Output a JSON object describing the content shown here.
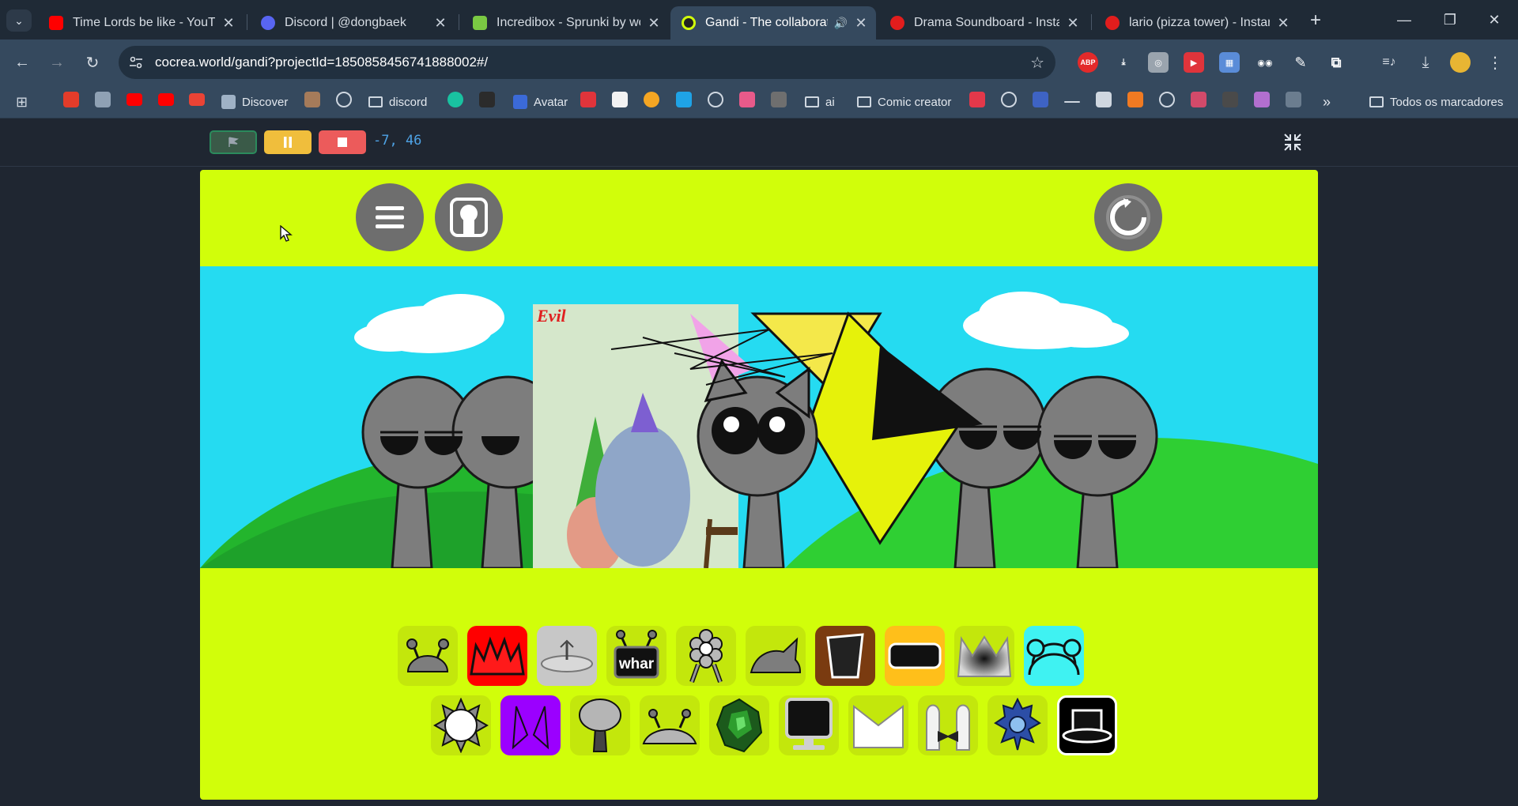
{
  "tabs": [
    {
      "title": "Time Lords be like - YouTube",
      "favicon": "youtube-icon",
      "color": "#ff0000"
    },
    {
      "title": "Discord | @dongbaek",
      "favicon": "discord-icon",
      "color": "#5865f2"
    },
    {
      "title": "Incredibox - Sprunki by wolfey",
      "favicon": "sprunki-icon",
      "color": "#7ac943"
    },
    {
      "title": "Gandi - The collaborative",
      "favicon": "gandi-icon",
      "color": "#d1fe0a",
      "active": true,
      "audio": true
    },
    {
      "title": "Drama Soundboard - Instant",
      "favicon": "myinstants-icon",
      "color": "#e11d1d"
    },
    {
      "title": "lario (pizza tower) - Instant",
      "favicon": "myinstants-icon",
      "color": "#e11d1d"
    }
  ],
  "address": {
    "url": "cocrea.world/gandi?projectId=1850858456741888002#/"
  },
  "extensions": [
    {
      "name": "adblock-icon",
      "label": "ABP",
      "color": "#e32a2a"
    },
    {
      "name": "download-helper-icon",
      "label": "⤓",
      "color": "#35495e"
    },
    {
      "name": "camera-ext-icon",
      "label": "◎",
      "color": "#9aa4ae"
    },
    {
      "name": "video-ext-icon",
      "label": "▶",
      "color": "#e0343b"
    },
    {
      "name": "photo-ext-icon",
      "label": "▦",
      "color": "#5a8cd8"
    },
    {
      "name": "glasses-ext-icon",
      "label": "◉◉",
      "color": "#35495e"
    },
    {
      "name": "pen-ext-icon",
      "label": "✎",
      "color": "#35495e"
    },
    {
      "name": "puzzle-icon",
      "label": "⧉",
      "color": "#35495e"
    }
  ],
  "bookmarks": {
    "discover": "Discover",
    "discord": "discord",
    "avatar": "Avatar",
    "ai": "ai",
    "comic": "Comic creator",
    "all": "Todos os marcadores"
  },
  "gandi": {
    "coords": "-7, 46",
    "scene_label": "Evil"
  },
  "tray": {
    "label_whar": "whar",
    "row1": [
      {
        "name": "tray-item-antenna-dome",
        "bg": "#c3e70c"
      },
      {
        "name": "tray-item-red-spikes",
        "bg": "#ff0000"
      },
      {
        "name": "tray-item-satellite",
        "bg": "#c7c7c7"
      },
      {
        "name": "tray-item-whar-screen",
        "bg": "#c3e70c"
      },
      {
        "name": "tray-item-flower-robot",
        "bg": "#c3e70c"
      },
      {
        "name": "tray-item-cat-ear",
        "bg": "#c3e70c"
      },
      {
        "name": "tray-item-bucket",
        "bg": "#7a3b10"
      },
      {
        "name": "tray-item-visor",
        "bg": "#ffbf1a"
      },
      {
        "name": "tray-item-crown",
        "bg": "#c3e70c"
      },
      {
        "name": "tray-item-headphones",
        "bg": "#3ff2f2"
      }
    ],
    "row2": [
      {
        "name": "tray-item-sun",
        "bg": "#c3e70c"
      },
      {
        "name": "tray-item-purple-horns",
        "bg": "#9b00ff"
      },
      {
        "name": "tray-item-tree",
        "bg": "#c3e70c"
      },
      {
        "name": "tray-item-crab",
        "bg": "#c3e70c"
      },
      {
        "name": "tray-item-green-gem",
        "bg": "#c3e70c"
      },
      {
        "name": "tray-item-computer",
        "bg": "#c3e70c"
      },
      {
        "name": "tray-item-white-crown",
        "bg": "#c3e70c"
      },
      {
        "name": "tray-item-bowtie",
        "bg": "#c3e70c"
      },
      {
        "name": "tray-item-blue-robot",
        "bg": "#c3e70c"
      },
      {
        "name": "tray-item-black-hat",
        "bg": "#000000"
      }
    ]
  }
}
